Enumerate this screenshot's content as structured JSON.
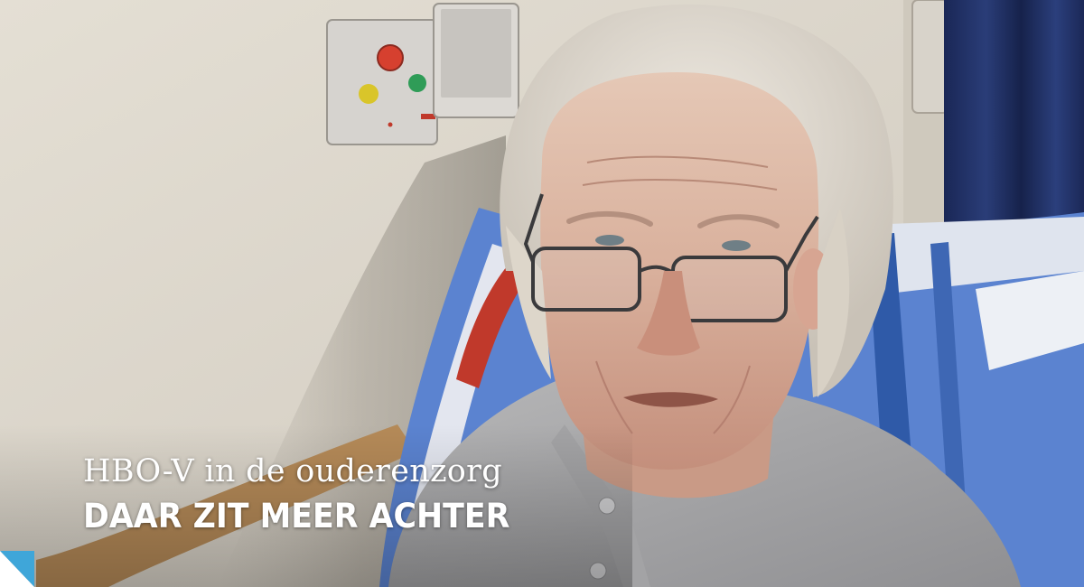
{
  "caption": {
    "subtitle": "HBO-V in de ouderenzorg",
    "headline": "DAAR ZIT MEER ACHTER"
  },
  "colors": {
    "caption_text": "#ffffff",
    "wall": "#dcd7cc",
    "curtain": "#1e2f63",
    "pillow_blue": "#3f6fc2",
    "shirt": "#a8a8aa",
    "corner_accent": "#3fa6d9"
  },
  "icons": {
    "call_button_red": "nurse-call-red-button",
    "call_button_yellow": "nurse-call-yellow-button",
    "call_button_green": "nurse-call-green-button",
    "intercom": "intercom-speaker",
    "glasses": "eyeglasses",
    "corner": "corner-accent-triangle"
  }
}
